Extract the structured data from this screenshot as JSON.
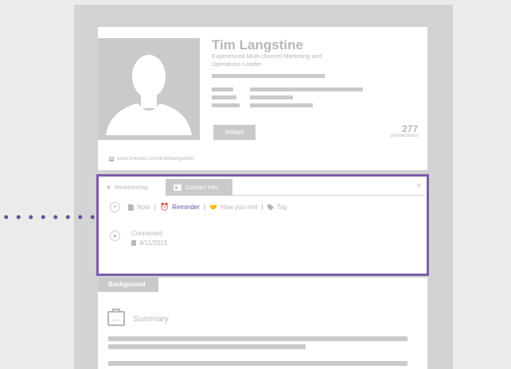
{
  "profile": {
    "name": "Tim Langstine",
    "headline": "Experienced Multi-channel Marketing and Operations Leader",
    "inmail_label": "InMail",
    "connections_count": "277",
    "connections_label": "connections",
    "public_url": "www.linkedin.com/in/timlangstine/"
  },
  "relationship": {
    "tabs": [
      {
        "label": "Relationship",
        "icon": "star-icon",
        "active": true
      },
      {
        "label": "Contact Info",
        "icon": "card-icon",
        "active": false
      }
    ],
    "actions": [
      {
        "label": "Note",
        "icon": "note-icon"
      },
      {
        "label": "Reminder",
        "icon": "alarm-clock-icon"
      },
      {
        "label": "How you met",
        "icon": "handshake-icon"
      },
      {
        "label": "Tag",
        "icon": "tag-icon"
      }
    ],
    "connected_label": "Connected",
    "connected_date": "4/11/2013"
  },
  "background": {
    "tab_label": "Background",
    "summary_label": "Summary"
  },
  "colors": {
    "accent_purple": "#7a5ca8",
    "placeholder_gray": "#c9cacc",
    "frame_gray": "#d2d3d5",
    "text_gray": "#b6b7b9"
  }
}
